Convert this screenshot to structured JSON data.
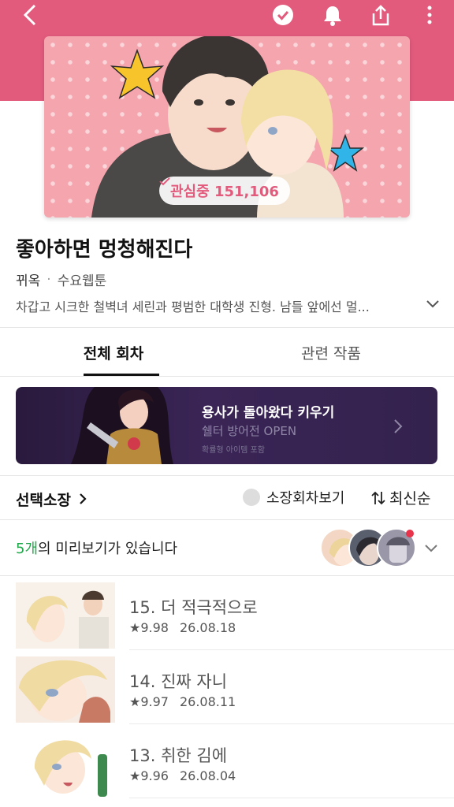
{
  "topbar": {
    "back_icon": "chevron-left-icon",
    "icons": [
      "check-circle-icon",
      "bell-icon",
      "share-icon",
      "more-vertical-icon"
    ]
  },
  "cover": {
    "follow_label": "관심중 151,106"
  },
  "info": {
    "title": "좋아하면 멍청해진다",
    "author": "뀌옥",
    "separator": "·",
    "day": "수요웹툰",
    "description": "차갑고 시크한 철벽녀 세린과 평범한 대학생 진형. 남들 앞에선 멀..."
  },
  "tabs": {
    "all_episodes": "전체 회차",
    "related": "관련 작품"
  },
  "banner": {
    "title": "용사가 돌아왔다 키우기",
    "subtitle": "쉘터 방어전 OPEN",
    "note": "확률형 아이템 포함"
  },
  "sortbar": {
    "bulk_buy": "선택소장",
    "owned_filter": "소장회차보기",
    "sort_label": "최신순"
  },
  "preview": {
    "count": "5개",
    "text": "의 미리보기가 있습니다"
  },
  "episodes": [
    {
      "title": "15. 더 적극적으로",
      "rating": "9.98",
      "date": "26.08.18"
    },
    {
      "title": "14. 진짜 자니",
      "rating": "9.97",
      "date": "26.08.11"
    },
    {
      "title": "13. 취한 김에",
      "rating": "9.96",
      "date": "26.08.04"
    }
  ],
  "colors": {
    "brand_pink": "#e25b7d",
    "preview_green": "#1fa849",
    "banner_bg": "#2a1a3d"
  }
}
